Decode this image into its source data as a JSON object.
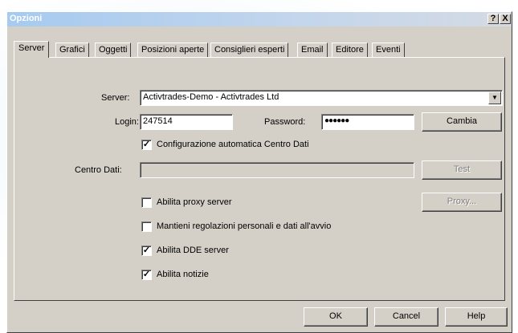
{
  "window": {
    "title": "Opzioni",
    "help_btn": "?",
    "close_btn": "X"
  },
  "tabs": [
    {
      "label": "Server",
      "active": true
    },
    {
      "label": "Grafici"
    },
    {
      "label": "Oggetti"
    },
    {
      "label": "Posizioni aperte"
    },
    {
      "label": "Consiglieri esperti"
    },
    {
      "label": "Email"
    },
    {
      "label": "Editore"
    },
    {
      "label": "Eventi"
    }
  ],
  "server": {
    "label": "Server:",
    "value": "Activtrades-Demo - Activtrades Ltd",
    "arrow": "▼"
  },
  "login": {
    "label": "Login:",
    "value": "247514"
  },
  "password": {
    "label": "Password:",
    "value": "●●●●●●"
  },
  "change_btn": "Cambia",
  "auto_config": {
    "label": "Configurazione automatica Centro Dati",
    "checked": true
  },
  "data_center": {
    "label": "Centro Dati:",
    "value": ""
  },
  "test_btn": "Test",
  "proxy_enable": {
    "label": "Abilita proxy server",
    "checked": false
  },
  "proxy_btn": "Proxy...",
  "keep_settings": {
    "label": "Mantieni regolazioni personali e dati all'avvio",
    "checked": false
  },
  "dde": {
    "label": "Abilita DDE server",
    "checked": true
  },
  "news": {
    "label": "Abilita notizie",
    "checked": true
  },
  "check_glyph": "✓",
  "footer": {
    "ok": "OK",
    "cancel": "Cancel",
    "help": "Help"
  }
}
